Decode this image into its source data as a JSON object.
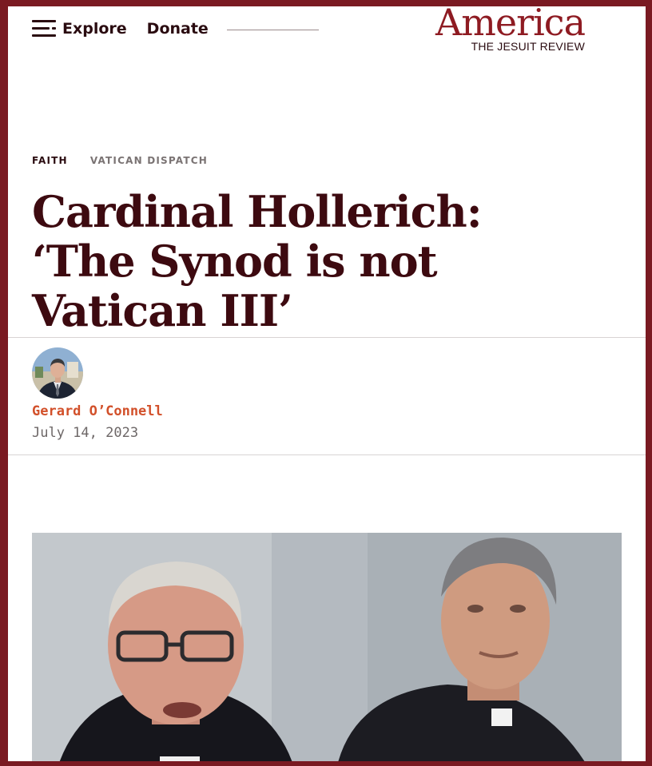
{
  "nav": {
    "explore_label": "Explore",
    "donate_label": "Donate"
  },
  "brand": {
    "title": "America",
    "subtitle": "THE JESUIT REVIEW"
  },
  "categories": [
    "FAITH",
    "VATICAN DISPATCH"
  ],
  "article": {
    "headline": "Cardinal Hollerich: ‘The Synod is not Vatican III’",
    "author": "Gerard O’Connell",
    "date": "July 14, 2023"
  },
  "colors": {
    "brand_red": "#8e1b22",
    "frame": "#7a1a22",
    "headline": "#3d0a10",
    "author": "#d2502a"
  },
  "icons": {
    "menu": "hamburger-menu-icon"
  }
}
